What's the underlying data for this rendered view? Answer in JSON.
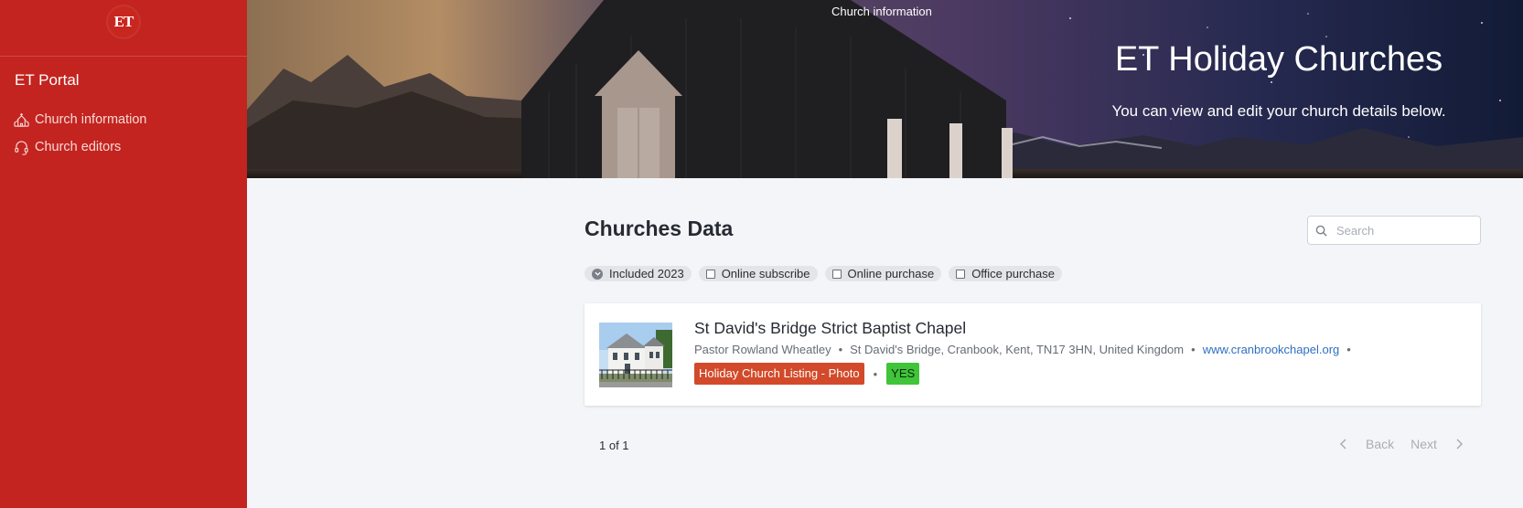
{
  "sidebar": {
    "logo_text": "ET",
    "portal_title": "ET Portal",
    "items": [
      {
        "label": "Church information",
        "icon": "church-icon"
      },
      {
        "label": "Church editors",
        "icon": "headset-icon"
      }
    ]
  },
  "hero": {
    "breadcrumb": "Church information",
    "title": "ET Holiday Churches",
    "subtitle": "You can view and edit your church details below."
  },
  "main": {
    "section_title": "Churches Data",
    "search": {
      "placeholder": "Search",
      "value": ""
    },
    "filters": [
      {
        "label": "Included 2023",
        "state": "selected"
      },
      {
        "label": "Online subscribe",
        "state": "unchecked"
      },
      {
        "label": "Online purchase",
        "state": "unchecked"
      },
      {
        "label": "Office purchase",
        "state": "unchecked"
      }
    ],
    "results": [
      {
        "name": "St David's Bridge Strict Baptist Chapel",
        "pastor": "Pastor Rowland Wheatley",
        "address": "St David's Bridge, Cranbook, Kent, TN17 3HN, United Kingdom",
        "website": "www.cranbrookchapel.org",
        "listing_tag": "Holiday Church Listing - Photo",
        "included": "YES"
      }
    ],
    "pagination": {
      "count_text": "1 of 1",
      "back_label": "Back",
      "next_label": "Next"
    }
  },
  "colors": {
    "sidebar_bg": "#c3241f",
    "tag_red": "#d24a2a",
    "tag_green": "#3fc43a",
    "link": "#2f6fc1",
    "page_bg": "#f4f5f8"
  }
}
